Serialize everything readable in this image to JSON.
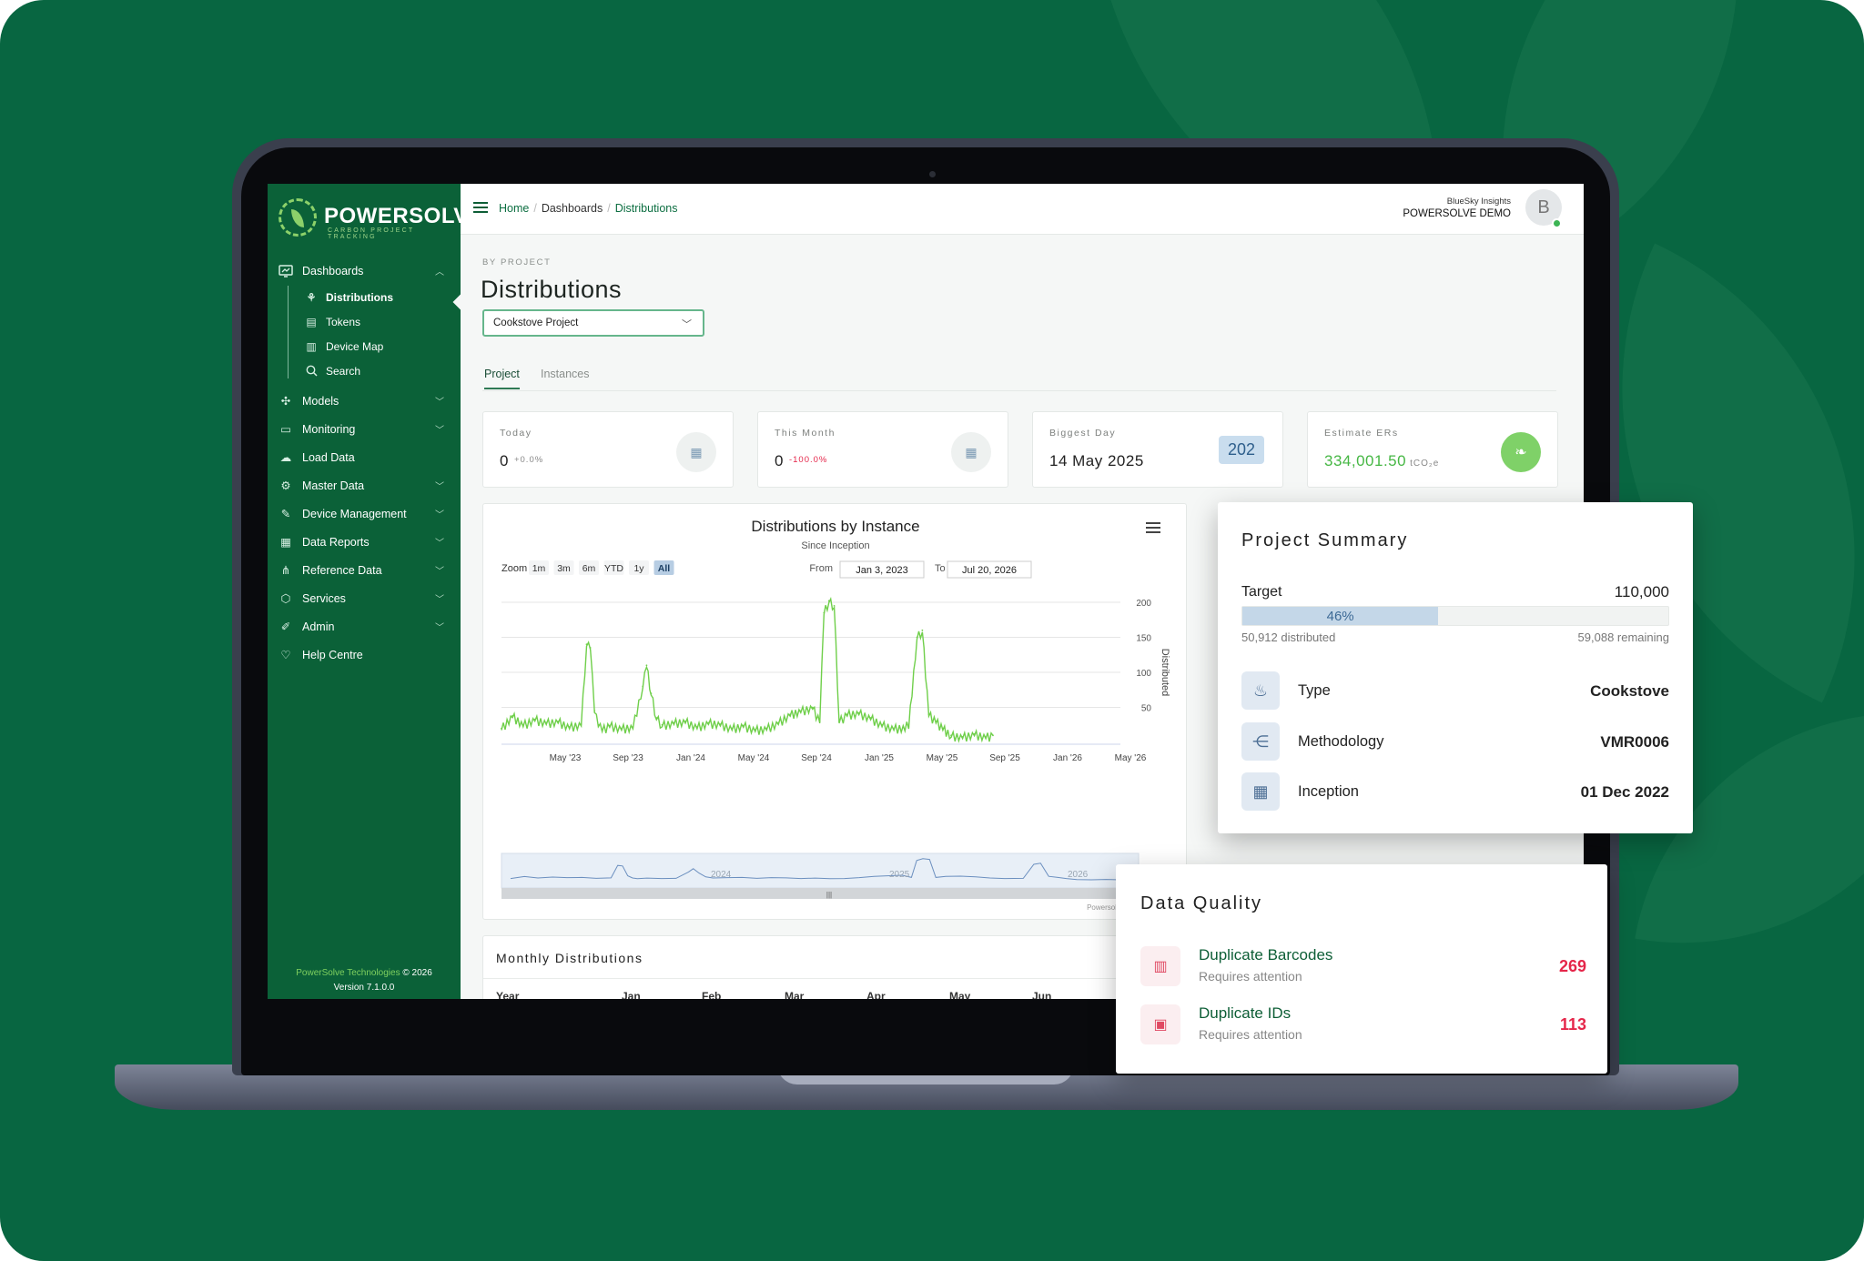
{
  "brand": {
    "name": "POWERSOLVE",
    "tagline": "CARBON PROJECT TRACKING"
  },
  "sidebar": {
    "items": [
      {
        "label": "Dashboards",
        "icon": "dashboard-icon",
        "expanded": true
      },
      {
        "label": "Models",
        "icon": "models-icon"
      },
      {
        "label": "Monitoring",
        "icon": "monitoring-icon"
      },
      {
        "label": "Load Data",
        "icon": "cloud-upload-icon"
      },
      {
        "label": "Master Data",
        "icon": "master-data-icon"
      },
      {
        "label": "Device Management",
        "icon": "device-management-icon"
      },
      {
        "label": "Data Reports",
        "icon": "data-reports-icon"
      },
      {
        "label": "Reference Data",
        "icon": "reference-data-icon"
      },
      {
        "label": "Services",
        "icon": "services-icon"
      },
      {
        "label": "Admin",
        "icon": "admin-icon"
      },
      {
        "label": "Help Centre",
        "icon": "heart-icon"
      }
    ],
    "subitems": [
      {
        "label": "Distributions",
        "icon": "distributions-icon",
        "active": true
      },
      {
        "label": "Tokens",
        "icon": "tokens-icon"
      },
      {
        "label": "Device Map",
        "icon": "map-icon"
      },
      {
        "label": "Search",
        "icon": "search-icon"
      }
    ],
    "footer": {
      "company": "PowerSolve Technologies",
      "copyright": "© 2026",
      "version": "Version 7.1.0.0"
    }
  },
  "header": {
    "breadcrumb": [
      "Home",
      "Dashboards",
      "Distributions"
    ],
    "org_name": "BlueSky Insights",
    "org_sub": "POWERSOLVE DEMO",
    "avatar_initial": "B"
  },
  "page": {
    "overline": "BY PROJECT",
    "title": "Distributions",
    "project_select": "Cookstove Project",
    "tabs": [
      "Project",
      "Instances"
    ],
    "active_tab": "Project"
  },
  "kpis": [
    {
      "label": "Today",
      "value": "0",
      "delta": "+0.0%",
      "delta_color": "#888888",
      "icon": "calendar-icon"
    },
    {
      "label": "This Month",
      "value": "0",
      "delta": "-100.0%",
      "delta_color": "#e5264a",
      "icon": "calendar-icon"
    },
    {
      "label": "Biggest Day",
      "value": "14 May 2025",
      "badge": "202"
    },
    {
      "label": "Estimate ERs",
      "value": "334,001.50",
      "unit": "tCO₂e",
      "icon": "leaf-icon"
    }
  ],
  "chart": {
    "title": "Distributions by Instance",
    "subtitle": "Since Inception",
    "zoom_label": "Zoom",
    "zoom_options": [
      "1m",
      "3m",
      "6m",
      "YTD",
      "1y",
      "All"
    ],
    "zoom_selected": "All",
    "from_label": "From",
    "from_value": "Jan 3, 2023",
    "to_label": "To",
    "to_value": "Jul 20, 2026",
    "credit": "Powersol",
    "navigator_labels": [
      "2024",
      "2025",
      "2026"
    ]
  },
  "chart_data": {
    "type": "line",
    "title": "Distributions by Instance",
    "subtitle": "Since Inception",
    "ylabel": "Distributed",
    "xlabel": "",
    "ylim": [
      0,
      200
    ],
    "y_ticks": [
      50,
      100,
      150,
      200
    ],
    "x_ticks": [
      "May '23",
      "Sep '23",
      "Jan '24",
      "May '24",
      "Sep '24",
      "Jan '25",
      "May '25",
      "Sep '25",
      "Jan '26",
      "May '26"
    ],
    "x_start": "2023-01-03",
    "x_end": "2026-07-20",
    "grid": true,
    "legend": "none",
    "color": "#6fcf4a",
    "series": [
      {
        "x": [
          "2023-01-03",
          "2023-02-01",
          "2023-03-01",
          "2023-04-01",
          "2023-05-01",
          "2023-06-01",
          "2023-07-01",
          "2023-08-01",
          "2023-08-15",
          "2023-08-25",
          "2023-09-05",
          "2023-09-15",
          "2023-09-25",
          "2023-10-15",
          "2023-11-15",
          "2023-12-15",
          "2024-01-10",
          "2024-01-20",
          "2024-02-01",
          "2024-02-15",
          "2024-03-01",
          "2024-04-01",
          "2024-05-01",
          "2024-06-01",
          "2024-07-01",
          "2024-08-01",
          "2024-09-01",
          "2024-10-01",
          "2024-11-01",
          "2024-12-01",
          "2025-01-01",
          "2025-02-01",
          "2025-03-01",
          "2025-04-01",
          "2025-04-20",
          "2025-05-01",
          "2025-05-14",
          "2025-05-28",
          "2025-06-10",
          "2025-07-01",
          "2025-08-01",
          "2025-09-01",
          "2025-10-01",
          "2025-11-01",
          "2025-12-10",
          "2026-01-01",
          "2026-01-15",
          "2026-02-01",
          "2026-02-20",
          "2026-03-10",
          "2026-04-01",
          "2026-05-01",
          "2026-06-01",
          "2026-07-01",
          "2026-07-20"
        ],
        "y": [
          20,
          38,
          25,
          33,
          28,
          30,
          22,
          26,
          140,
          135,
          45,
          25,
          18,
          24,
          20,
          22,
          80,
          110,
          70,
          35,
          25,
          28,
          30,
          22,
          28,
          26,
          20,
          24,
          18,
          20,
          28,
          40,
          45,
          50,
          30,
          185,
          202,
          195,
          30,
          40,
          42,
          35,
          25,
          20,
          22,
          150,
          160,
          40,
          30,
          20,
          10,
          8,
          12,
          8,
          10
        ]
      }
    ]
  },
  "monthly": {
    "title": "Monthly Distributions",
    "headers": [
      "Year",
      "Jan",
      "Feb",
      "Mar",
      "Apr",
      "May",
      "Jun"
    ]
  },
  "summary": {
    "title": "Project Summary",
    "target_label": "Target",
    "target_value": "110,000",
    "progress_pct": 46,
    "progress_label": "46%",
    "distributed": "50,912 distributed",
    "remaining": "59,088 remaining",
    "rows": [
      {
        "label": "Type",
        "value": "Cookstove",
        "icon": "flame-icon"
      },
      {
        "label": "Methodology",
        "value": "VMR0006",
        "icon": "share-nodes-icon"
      },
      {
        "label": "Inception",
        "value": "01 Dec 2022",
        "icon": "calendar-icon"
      }
    ]
  },
  "quality": {
    "title": "Data Quality",
    "rows": [
      {
        "label": "Duplicate Barcodes",
        "sub": "Requires attention",
        "value": "269",
        "icon": "barcode-scan-icon"
      },
      {
        "label": "Duplicate IDs",
        "sub": "Requires attention",
        "value": "113",
        "icon": "id-card-icon"
      }
    ]
  },
  "colors": {
    "brand_green": "#086641",
    "sidebar": "#0b6138",
    "chart_line": "#6fcf4a",
    "alert_red": "#e5264a",
    "er_green": "#46b744"
  }
}
